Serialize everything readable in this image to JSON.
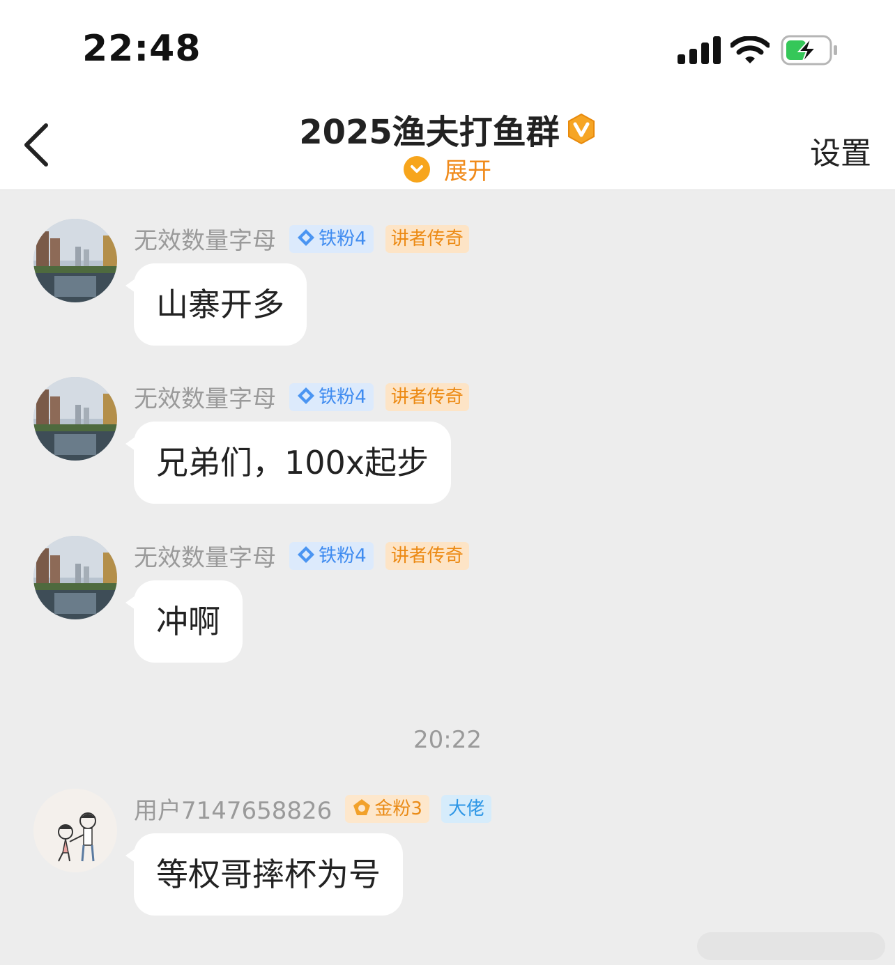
{
  "status_bar": {
    "time": "22:48",
    "icons": [
      "signal-icon",
      "wifi-icon",
      "battery-charging-icon"
    ]
  },
  "header": {
    "title": "2025渔夫打鱼群",
    "verified_icon": "v-badge-icon",
    "expand_label": "展开",
    "settings_label": "设置",
    "colors": {
      "accent": "#f08a1a",
      "badge_orange": "#f7a51c"
    }
  },
  "messages": [
    {
      "username": "无效数量字母",
      "fan_badge": "铁粉4",
      "title_badge": "讲者传奇",
      "text": "山寨开多",
      "avatar": "river-city-avatar"
    },
    {
      "username": "无效数量字母",
      "fan_badge": "铁粉4",
      "title_badge": "讲者传奇",
      "text": "兄弟们，100x起步",
      "avatar": "river-city-avatar"
    },
    {
      "username": "无效数量字母",
      "fan_badge": "铁粉4",
      "title_badge": "讲者传奇",
      "text": "冲啊",
      "avatar": "river-city-avatar"
    }
  ],
  "timestamp": "20:22",
  "last_message": {
    "username": "用户7147658826",
    "fan_badge": "金粉3",
    "title_badge": "大佬",
    "text": "等权哥摔杯为号",
    "avatar": "couple-sketch-avatar"
  }
}
